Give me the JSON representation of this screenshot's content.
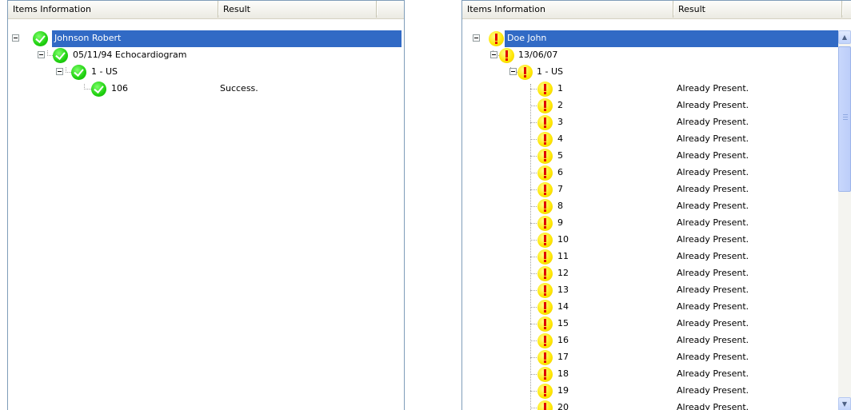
{
  "left_panel": {
    "columns": {
      "items": "Items Information",
      "result": "Result"
    },
    "root": {
      "label": "Johnson Robert",
      "status": "success-icon"
    },
    "study": {
      "label": "05/11/94 Echocardiogram"
    },
    "series": {
      "label": "1 - US"
    },
    "image": {
      "label": "106",
      "result": "Success."
    }
  },
  "right_panel": {
    "columns": {
      "items": "Items Information",
      "result": "Result"
    },
    "root": {
      "label": "Doe John",
      "status": "warning-icon"
    },
    "study": {
      "label": "13/06/07"
    },
    "series": {
      "label": "1 - US"
    },
    "items": [
      {
        "label": "1",
        "result": "Already Present."
      },
      {
        "label": "2",
        "result": "Already Present."
      },
      {
        "label": "3",
        "result": "Already Present."
      },
      {
        "label": "4",
        "result": "Already Present."
      },
      {
        "label": "5",
        "result": "Already Present."
      },
      {
        "label": "6",
        "result": "Already Present."
      },
      {
        "label": "7",
        "result": "Already Present."
      },
      {
        "label": "8",
        "result": "Already Present."
      },
      {
        "label": "9",
        "result": "Already Present."
      },
      {
        "label": "10",
        "result": "Already Present."
      },
      {
        "label": "11",
        "result": "Already Present."
      },
      {
        "label": "12",
        "result": "Already Present."
      },
      {
        "label": "13",
        "result": "Already Present."
      },
      {
        "label": "14",
        "result": "Already Present."
      },
      {
        "label": "15",
        "result": "Already Present."
      },
      {
        "label": "16",
        "result": "Already Present."
      },
      {
        "label": "17",
        "result": "Already Present."
      },
      {
        "label": "18",
        "result": "Already Present."
      },
      {
        "label": "19",
        "result": "Already Present."
      },
      {
        "label": "20",
        "result": "Already Present."
      }
    ]
  },
  "colors": {
    "selection": "#316ac5",
    "success": "#1fd10f",
    "warning": "#ffe600",
    "warning_mark": "#e00000"
  }
}
